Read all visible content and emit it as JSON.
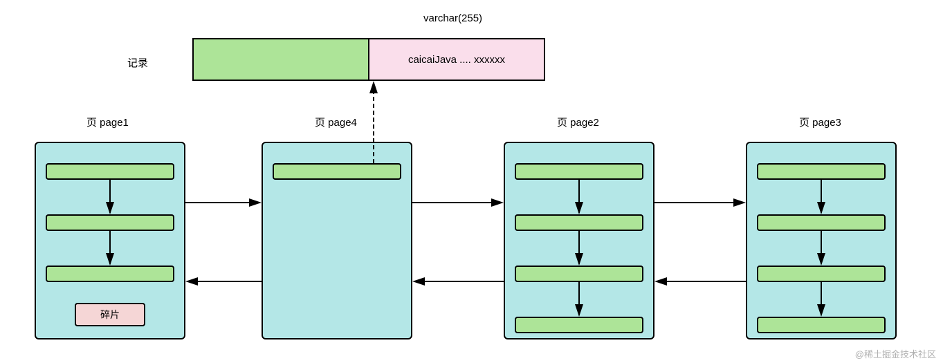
{
  "top": {
    "varchar_label": "varchar(255)",
    "record_label": "记录",
    "record_value": "caicaiJava .... xxxxxx"
  },
  "pages": {
    "p1": {
      "title": "页 page1",
      "fragment_label": "碎片"
    },
    "p4": {
      "title": "页 page4"
    },
    "p2": {
      "title": "页 page2"
    },
    "p3": {
      "title": "页 page3"
    }
  },
  "watermark": "@稀土掘金技术社区"
}
